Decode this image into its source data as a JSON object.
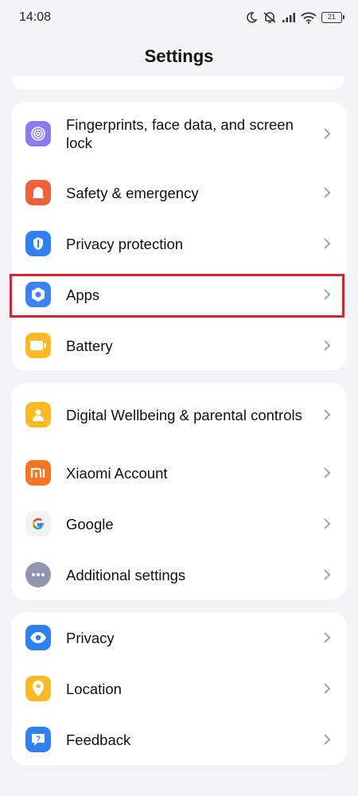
{
  "status_bar": {
    "time": "14:08",
    "battery": "21"
  },
  "header": {
    "title": "Settings"
  },
  "groups": [
    {
      "items": [
        {
          "label": "Fingerprints, face data, and screen lock",
          "icon": "fingerprint-icon",
          "color": "#8a7cf0"
        },
        {
          "label": "Safety & emergency",
          "icon": "alert-bell-icon",
          "color": "#f0613a"
        },
        {
          "label": "Privacy protection",
          "icon": "shield-icon",
          "color": "#2f80f5"
        },
        {
          "label": "Apps",
          "icon": "apps-gear-icon",
          "color": "#3b82f6"
        },
        {
          "label": "Battery",
          "icon": "battery-icon",
          "color": "#fbb923"
        }
      ]
    },
    {
      "items": [
        {
          "label": "Digital Wellbeing & parental controls",
          "icon": "wellbeing-icon",
          "color": "#fbb923"
        },
        {
          "label": "Xiaomi Account",
          "icon": "mi-logo-icon",
          "color": "#f47524"
        },
        {
          "label": "Google",
          "icon": "google-g-icon",
          "color": "#f3f3f3"
        },
        {
          "label": "Additional settings",
          "icon": "more-dots-icon",
          "color": "#8e96ad"
        }
      ]
    },
    {
      "items": [
        {
          "label": "Privacy",
          "icon": "eye-icon",
          "color": "#2f80f5"
        },
        {
          "label": "Location",
          "icon": "location-pin-icon",
          "color": "#fbb923"
        },
        {
          "label": "Feedback",
          "icon": "feedback-icon",
          "color": "#2f80f5"
        }
      ]
    }
  ],
  "highlight_color": "#d9232d"
}
